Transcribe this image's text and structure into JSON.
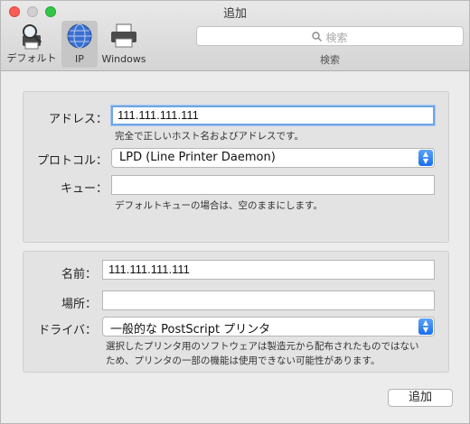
{
  "window": {
    "title": "追加"
  },
  "toolbar": {
    "items": [
      {
        "label": "デフォルト",
        "icon": "default-printer-icon",
        "selected": false
      },
      {
        "label": "IP",
        "icon": "ip-globe-icon",
        "selected": true
      },
      {
        "label": "Windows",
        "icon": "windows-printer-icon",
        "selected": false
      }
    ],
    "search": {
      "placeholder": "検索",
      "label": "検索"
    }
  },
  "connection": {
    "address": {
      "label": "アドレス：",
      "value": "111.111.111.111",
      "hint": "完全で正しいホスト名およびアドレスです。"
    },
    "protocol": {
      "label": "プロトコル：",
      "value": "LPD (Line Printer Daemon)"
    },
    "queue": {
      "label": "キュー：",
      "value": "",
      "hint": "デフォルトキューの場合は、空のままにします。"
    }
  },
  "printer": {
    "name": {
      "label": "名前：",
      "value": "111.111.111.111"
    },
    "location": {
      "label": "場所：",
      "value": ""
    },
    "driver": {
      "label": "ドライバ：",
      "value": "一般的な PostScript プリンタ",
      "hint_line1": "選択したプリンタ用のソフトウェアは製造元から配布されたものではない",
      "hint_line2": "ため、プリンタの一部の機能は使用できない可能性があります。"
    }
  },
  "actions": {
    "add_label": "追加"
  },
  "colors": {
    "close": "#fc5b57",
    "maximize": "#35c649",
    "focus_ring": "#6ea4e8",
    "popup_accent": "#1a6ef0"
  }
}
